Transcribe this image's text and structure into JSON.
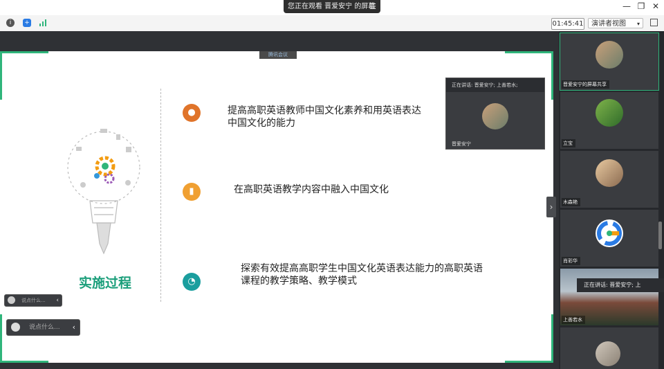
{
  "window": {
    "title": "您正在观看 晋爱安宁 的屏幕",
    "menu_glyph": "☰",
    "controls": [
      "—",
      "❐",
      "✕"
    ]
  },
  "toolbar": {
    "timer": "01:45:41",
    "view_label": "演讲者视图",
    "view_arrow": "▾"
  },
  "slide": {
    "rec_tag": "腾讯会议",
    "title": "实施过程",
    "items": [
      {
        "text_line1": "提高高职英语教师中国文化素养和用英语表达",
        "text_line2": "中国文化的能力",
        "color": "#e0742a"
      },
      {
        "text_line1": "在高职英语教学内容中融入中国文化",
        "text_line2": "",
        "color": "#f0a032"
      },
      {
        "text_line1": "探索有效提高高职学生中国文化英语表达能力的高职英语",
        "text_line2": "课程的教学策略、教学模式",
        "color": "#1a9e9e"
      }
    ]
  },
  "float_video": {
    "header": "正在讲话: 晋爱安宁; 上善若水;",
    "name": "晋爱安宁"
  },
  "chat": {
    "small_placeholder": "说点什么...",
    "large_placeholder": "说点什么...",
    "collapse_glyph": "‹"
  },
  "collapse_glyph": "›",
  "participants": [
    {
      "name": "晋爱安宁的屏幕共享"
    },
    {
      "name": "立宝"
    },
    {
      "name": "木森艳"
    },
    {
      "name": "肖彩华"
    },
    {
      "name": "上善若水"
    },
    {
      "name": ""
    }
  ],
  "speaking_banner": "正在讲话: 晋爱安宁; 上"
}
